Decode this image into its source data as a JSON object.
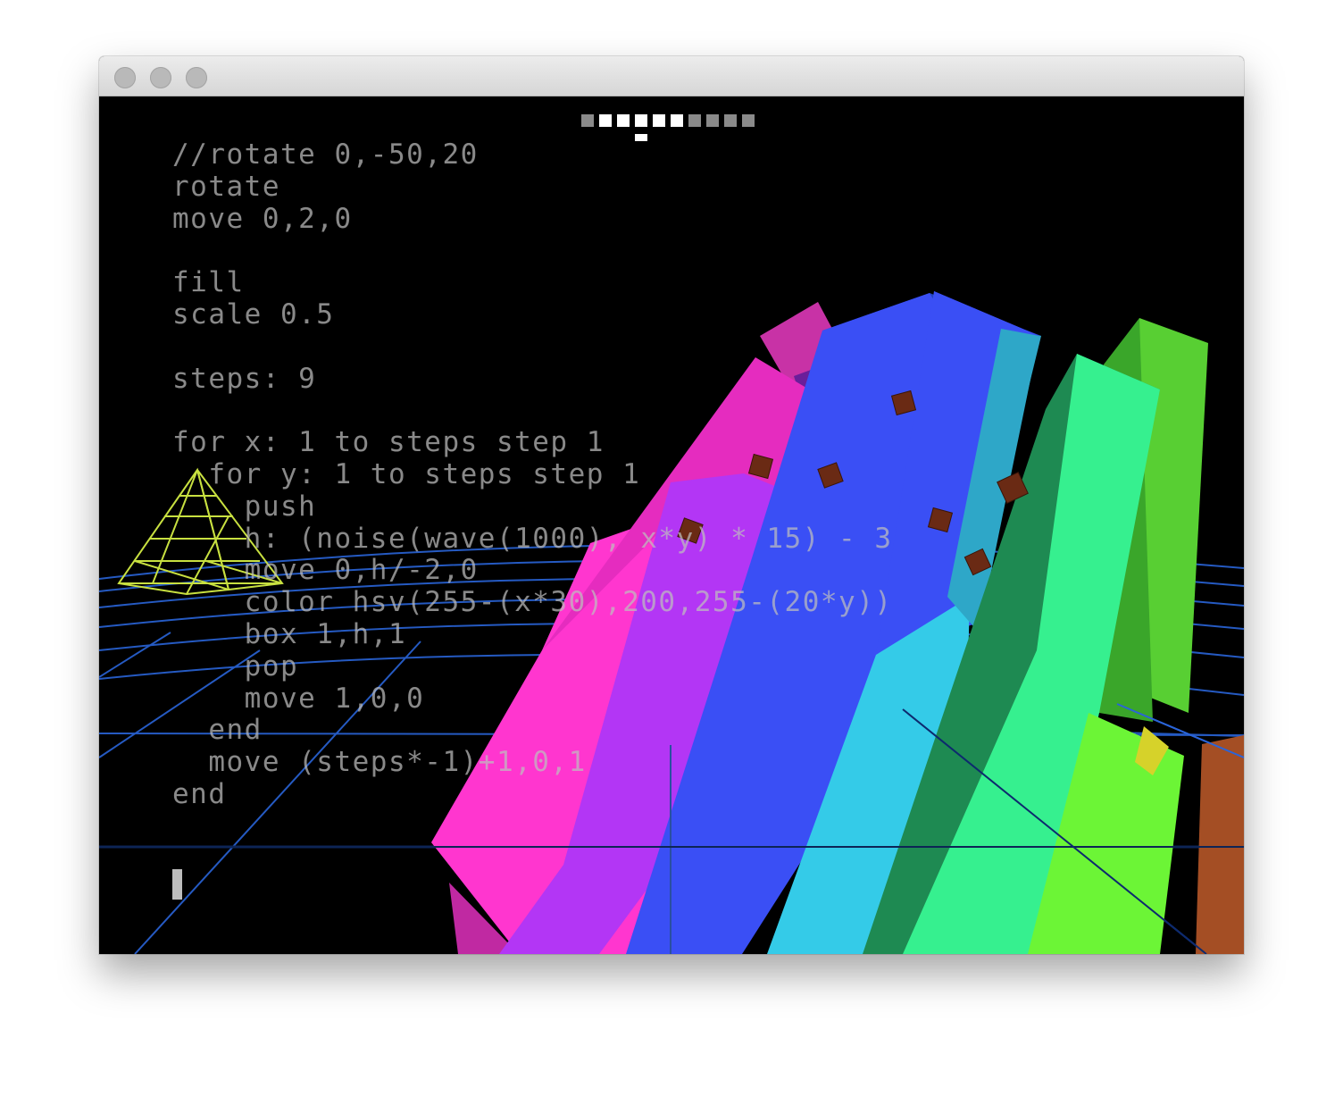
{
  "window": {
    "traffic_lights": [
      "close-button",
      "minimize-button",
      "zoom-button"
    ]
  },
  "editor": {
    "code_lines": [
      "//rotate 0,-50,20",
      "rotate",
      "move 0,2,0",
      "",
      "fill",
      "scale 0.5",
      "",
      "steps: 9",
      "",
      "for x: 1 to steps step 1",
      "  for y: 1 to steps step 1",
      "    push",
      "    h: (noise(wave(1000), x*y) * 15) - 3",
      "    move 0,h/-2,0",
      "    color hsv(255-(x*30),200,255-(20*y))",
      "    box 1,h,1",
      "    pop",
      "    move 1,0,0",
      "  end",
      "  move (steps*-1)+1,0,1",
      "end"
    ],
    "text_color": "#bebebe"
  },
  "indicator": {
    "blocks": 10,
    "lit": [
      1,
      2,
      3,
      4,
      5
    ],
    "current": 3,
    "lit_color": "#ffffff",
    "dim_color": "#8a8a8a"
  },
  "scene": {
    "background": "#000000",
    "grid_color": "#2a64d8",
    "pyramid_color": "#c8e040",
    "bar_colors": [
      "#ff36cf",
      "#b336f5",
      "#3a4ff5",
      "#34cbe8",
      "#36f08f",
      "#6cf536",
      "#a44e24"
    ]
  }
}
